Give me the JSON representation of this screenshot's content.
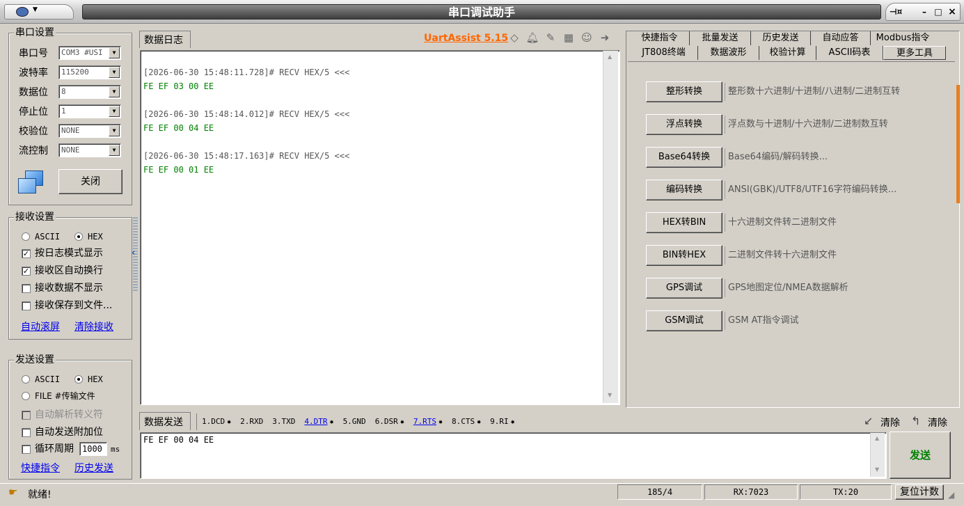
{
  "window": {
    "title": "串口调试助手",
    "system_menu_icon": "app-menu-icon",
    "pin_glyph": "⊣¤",
    "min_glyph": "–",
    "max_glyph": "□",
    "close_glyph": "×"
  },
  "serial_settings": {
    "title": "串口设置",
    "fields": [
      {
        "label": "串口号",
        "value": "COM3 #USI"
      },
      {
        "label": "波特率",
        "value": "115200"
      },
      {
        "label": "数据位",
        "value": "8"
      },
      {
        "label": "停止位",
        "value": "1"
      },
      {
        "label": "校验位",
        "value": "NONE"
      },
      {
        "label": "流控制",
        "value": "NONE"
      }
    ],
    "port_icon": "serial-port-icon",
    "close_button": "关闭"
  },
  "receive_settings": {
    "title": "接收设置",
    "radio_ascii": "ASCII",
    "radio_hex": "HEX",
    "options": [
      {
        "label": "按日志模式显示",
        "checked": true
      },
      {
        "label": "接收区自动换行",
        "checked": true
      },
      {
        "label": "接收数据不显示",
        "checked": false
      },
      {
        "label": "接收保存到文件...",
        "checked": false
      }
    ],
    "link_autoscroll": "自动滚屏",
    "link_clear": "清除接收"
  },
  "send_settings": {
    "title": "发送设置",
    "radio_ascii": "ASCII",
    "radio_hex": "HEX",
    "radio_file": "FILE #传输文件",
    "options": [
      {
        "label": "自动解析转义符",
        "checked": false,
        "disabled": true
      },
      {
        "label": "自动发送附加位",
        "checked": false,
        "disabled": false
      }
    ],
    "cycle_label": "循环周期",
    "cycle_value": "1000",
    "cycle_unit": "ms",
    "link_quick": "快捷指令",
    "link_history": "历史发送"
  },
  "log": {
    "tab": "数据日志",
    "brand": "UartAssist 5.15",
    "icons": [
      "diamond-icon",
      "bell-icon",
      "edit-icon",
      "calculator-icon",
      "smiley-icon",
      "forward-icon"
    ],
    "entries": [
      {
        "header": "[2026-06-30 15:48:11.728]# RECV HEX/5 <<<",
        "data": "FE EF 03 00 EE"
      },
      {
        "header": "[2026-06-30 15:48:14.012]# RECV HEX/5 <<<",
        "data": "FE EF 00 04 EE"
      },
      {
        "header": "[2026-06-30 15:48:17.163]# RECV HEX/5 <<<",
        "data": "FE EF 00 01 EE"
      }
    ]
  },
  "tools": {
    "tabs_row1": [
      "快捷指令",
      "批量发送",
      "历史发送",
      "自动应答",
      "Modbus指令"
    ],
    "tabs_row2": [
      "JT808终端",
      "数据波形",
      "校验计算",
      "ASCII码表",
      "更多工具"
    ],
    "active_tab": "更多工具",
    "items": [
      {
        "button": "整形转换",
        "desc": "整形数十六进制/十进制/八进制/二进制互转"
      },
      {
        "button": "浮点转换",
        "desc": "浮点数与十进制/十六进制/二进制数互转"
      },
      {
        "button": "Base64转换",
        "desc": "Base64编码/解码转换..."
      },
      {
        "button": "编码转换",
        "desc": "ANSI(GBK)/UTF8/UTF16字符编码转换..."
      },
      {
        "button": "HEX转BIN",
        "desc": "十六进制文件转二进制文件"
      },
      {
        "button": "BIN转HEX",
        "desc": "二进制文件转十六进制文件"
      },
      {
        "button": "GPS调试",
        "desc": "GPS地图定位/NMEA数据解析"
      },
      {
        "button": "GSM调试",
        "desc": "GSM AT指令调试"
      }
    ]
  },
  "send_area": {
    "tab": "数据发送",
    "signals": [
      {
        "label": "1.DCD",
        "dot": true,
        "link": false
      },
      {
        "label": "2.RXD",
        "dot": false,
        "link": false
      },
      {
        "label": "3.TXD",
        "dot": false,
        "link": false
      },
      {
        "label": "4.DTR",
        "dot": true,
        "link": true
      },
      {
        "label": "5.GND",
        "dot": false,
        "link": false
      },
      {
        "label": "6.DSR",
        "dot": true,
        "link": false
      },
      {
        "label": "7.RTS",
        "dot": true,
        "link": true
      },
      {
        "label": "8.CTS",
        "dot": true,
        "link": false
      },
      {
        "label": "9.RI",
        "dot": true,
        "link": false
      }
    ],
    "clear_left": "清除",
    "clear_right": "清除",
    "content": "FE EF 00 04 EE",
    "send_button": "发送"
  },
  "status": {
    "text": "就绪!",
    "counter": "185/4",
    "rx": "RX:7023",
    "tx": "TX:20",
    "reset": "复位计数"
  },
  "colors": {
    "window_bg": "#d4d0c8",
    "log_header": "#555555",
    "log_data": "#008000",
    "brand": "#ff6600",
    "send_button_text": "#008000",
    "link": "#0000ee"
  }
}
